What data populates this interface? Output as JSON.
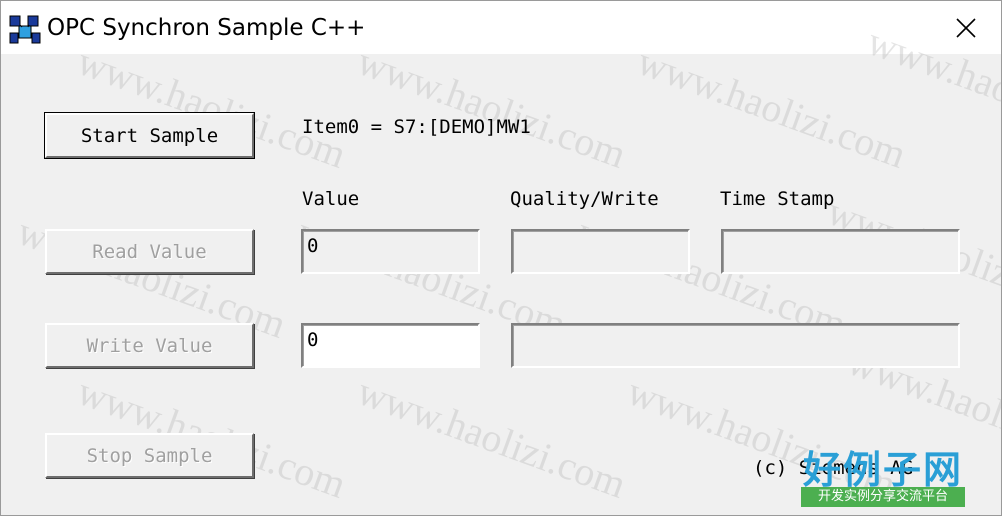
{
  "window": {
    "title": "OPC Synchron Sample C++"
  },
  "buttons": {
    "start": "Start Sample",
    "read": "Read Value",
    "write": "Write Value",
    "stop": "Stop Sample"
  },
  "item_label": "Item0 = S7:[DEMO]MW1",
  "columns": {
    "value": "Value",
    "quality": "Quality/Write",
    "timestamp": "Time Stamp"
  },
  "fields": {
    "read_value": "0",
    "read_quality": "",
    "read_timestamp": "",
    "write_value": "0",
    "write_result": ""
  },
  "copyright": "(c) Siemens AG",
  "watermark": "www.haolizi.com",
  "logo": {
    "title": "好例子网",
    "subtitle": "开发实例分享交流平台",
    "title_color": "#2a9fd6",
    "subtitle_bg": "#4caf50"
  },
  "icons": {
    "app": "opc-app-icon",
    "close": "close-icon"
  }
}
